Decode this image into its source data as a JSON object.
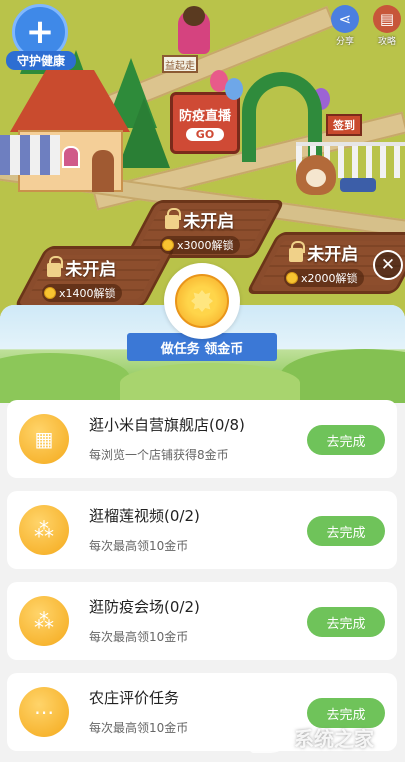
{
  "scene": {
    "health_badge": "守护健康",
    "share_label": "分享",
    "guide_label": "攻略",
    "street_sign": "益起走",
    "live_board_title": "防疫直播",
    "live_board_go": "GO",
    "checkin_sign": "签到",
    "plots": [
      {
        "status": "未开启",
        "cost": "x3000解锁"
      },
      {
        "status": "未开启",
        "cost": "x1400解锁"
      },
      {
        "status": "未开启",
        "cost": "x2000解锁"
      }
    ]
  },
  "panel": {
    "ribbon": "做任务 领金币",
    "close_icon": "close-icon",
    "tasks": [
      {
        "icon": "shop-icon",
        "title": "逛小米自营旗舰店(0/8)",
        "desc": "每浏览一个店铺获得8金币",
        "button": "去完成"
      },
      {
        "icon": "footprints-icon",
        "title": "逛榴莲视频(0/2)",
        "desc": "每次最高领10金币",
        "button": "去完成"
      },
      {
        "icon": "footprints-icon",
        "title": "逛防疫会场(0/2)",
        "desc": "每次最高领10金币",
        "button": "去完成"
      },
      {
        "icon": "chat-icon",
        "title": "农庄评价任务",
        "desc": "每次最高领10金币",
        "button": "去完成"
      }
    ]
  },
  "watermark": "系统之家",
  "colors": {
    "grass": "#b9c34a",
    "task_button": "#6fc35a",
    "icon_orange": "#f4a91b",
    "ribbon_blue": "#3b78d6",
    "health_blue": "#3f89e8"
  }
}
